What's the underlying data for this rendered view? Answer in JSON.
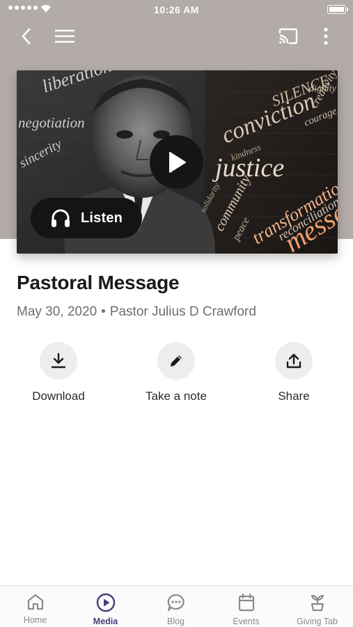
{
  "status_bar": {
    "time": "10:26 AM"
  },
  "nav": {
    "icons": [
      "back-chevron-icon",
      "menu-icon",
      "cast-icon",
      "more-vertical-icon"
    ]
  },
  "hero": {
    "listen_label": "Listen",
    "artwork_words": [
      "liberation",
      "negotiation",
      "sincerity",
      "conviction",
      "SILENCE",
      "justice",
      "community",
      "peace",
      "solidarity",
      "transformation",
      "reconciliation",
      "message",
      "dignity",
      "creativity",
      "kindness",
      "courage"
    ]
  },
  "sermon": {
    "title": "Pastoral Message",
    "date": "May 30, 2020",
    "separator": "•",
    "speaker": "Pastor Julius D Crawford"
  },
  "actions": [
    {
      "label": "Download",
      "icon": "download-icon"
    },
    {
      "label": "Take a note",
      "icon": "pencil-icon"
    },
    {
      "label": "Share",
      "icon": "share-icon"
    }
  ],
  "tabs": [
    {
      "label": "Home",
      "icon": "home-icon",
      "active": false
    },
    {
      "label": "Media",
      "icon": "play-circle-icon",
      "active": true
    },
    {
      "label": "Blog",
      "icon": "chat-bubble-icon",
      "active": false
    },
    {
      "label": "Events",
      "icon": "calendar-icon",
      "active": false
    },
    {
      "label": "Giving Tab",
      "icon": "plant-icon",
      "active": false
    }
  ],
  "colors": {
    "header_bg": "#b3aba8",
    "active_tab": "#4a3a7a",
    "inactive_tab": "#8a8a8a",
    "action_circle": "#ededed"
  }
}
